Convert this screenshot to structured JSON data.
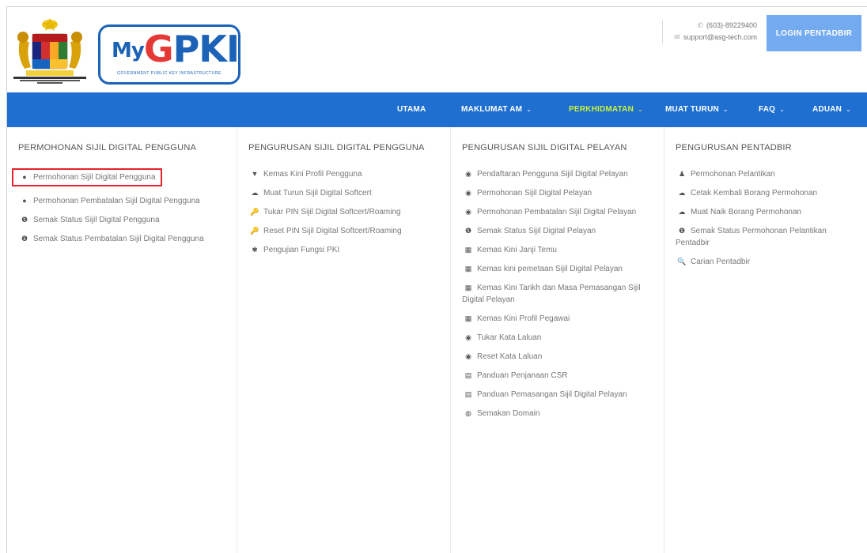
{
  "header": {
    "contact_phone": "(603)-89229400",
    "contact_email": "support@asg-tech.com",
    "login_label": "LOGIN PENTADBIR",
    "logo": {
      "my": "My",
      "g": "G",
      "pki": "PKI",
      "tagline": "GOVERNMENT PUBLIC KEY INFRASTRUCTURE"
    }
  },
  "nav": {
    "items": [
      {
        "label": "UTAMA",
        "caret": false
      },
      {
        "label": "MAKLUMAT AM",
        "caret": true
      },
      {
        "label": "PERKHIDMATAN",
        "caret": true,
        "active": true
      },
      {
        "label": "MUAT TURUN",
        "caret": true
      },
      {
        "label": "FAQ",
        "caret": true
      },
      {
        "label": "ADUAN",
        "caret": true
      }
    ],
    "caret_symbol": "⌄"
  },
  "menu": {
    "columns": [
      {
        "title": "PERMOHONAN SIJIL DIGITAL PENGGUNA",
        "items": [
          {
            "icon": "●",
            "label": "Permohonan Sijil Digital Pengguna",
            "highlighted": true
          },
          {
            "icon": "●",
            "label": "Permohonan Pembatalan Sijil Digital Pengguna"
          },
          {
            "icon": "❶",
            "label": "Semak Status Sijil Digital Pengguna"
          },
          {
            "icon": "❶",
            "label": "Semak Status Pembatalan Sijil Digital Pengguna"
          }
        ]
      },
      {
        "title": "PENGURUSAN SIJIL DIGITAL PENGGUNA",
        "items": [
          {
            "icon": "▼",
            "label": "Kemas Kini Profil Pengguna"
          },
          {
            "icon": "☁",
            "label": "Muat Turun Sijil Digital Softcert"
          },
          {
            "icon": "🔑",
            "label": "Tukar PIN Sijil Digital Softcert/Roaming"
          },
          {
            "icon": "🔑",
            "label": "Reset PIN Sijil Digital Softcert/Roaming"
          },
          {
            "icon": "✱",
            "label": "Pengujian Fungsi PKI"
          }
        ]
      },
      {
        "title": "PENGURUSAN SIJIL DIGITAL PELAYAN",
        "items": [
          {
            "icon": "◉",
            "label": "Pendaftaran Pengguna Sijil Digital Pelayan"
          },
          {
            "icon": "◉",
            "label": "Permohonan Sijil Digital Pelayan"
          },
          {
            "icon": "◉",
            "label": "Permohonan Pembatalan Sijil Digital Pelayan"
          },
          {
            "icon": "❶",
            "label": "Semak Status Sijil Digital Pelayan"
          },
          {
            "icon": "▦",
            "label": "Kemas Kini Janji Temu"
          },
          {
            "icon": "▦",
            "label": "Kemas kini pemetaan Sijil Digital Pelayan"
          },
          {
            "icon": "▦",
            "label": "Kemas Kini Tarikh dan Masa Pemasangan Sijil Digital Pelayan"
          },
          {
            "icon": "▦",
            "label": "Kemas Kini Profil Pegawai"
          },
          {
            "icon": "◉",
            "label": "Tukar Kata Laluan"
          },
          {
            "icon": "◉",
            "label": "Reset Kata Laluan"
          },
          {
            "icon": "▤",
            "label": "Panduan Penjanaan CSR"
          },
          {
            "icon": "▤",
            "label": "Panduan Pemasangan Sijil Digital Pelayan"
          },
          {
            "icon": "◍",
            "label": "Semakan Domain"
          }
        ]
      },
      {
        "title": "PENGURUSAN PENTADBIR",
        "items": [
          {
            "icon": "♟",
            "label": "Permohonan Pelantikan"
          },
          {
            "icon": "☁",
            "label": "Cetak Kembali Borang Permohonan"
          },
          {
            "icon": "☁",
            "label": "Muat Naik Borang Permohonan"
          },
          {
            "icon": "❶",
            "label": "Semak Status Permohonan Pelantikan Pentadbir"
          },
          {
            "icon": "🔍",
            "label": "Carian Pentadbir"
          }
        ]
      }
    ]
  },
  "colors": {
    "nav_bg": "#1f6fd1",
    "nav_active": "#c8f03c",
    "login_bg": "#74aaf0",
    "highlight_border": "#e4232c",
    "logo_blue": "#1c63b8",
    "logo_red": "#e53935"
  }
}
